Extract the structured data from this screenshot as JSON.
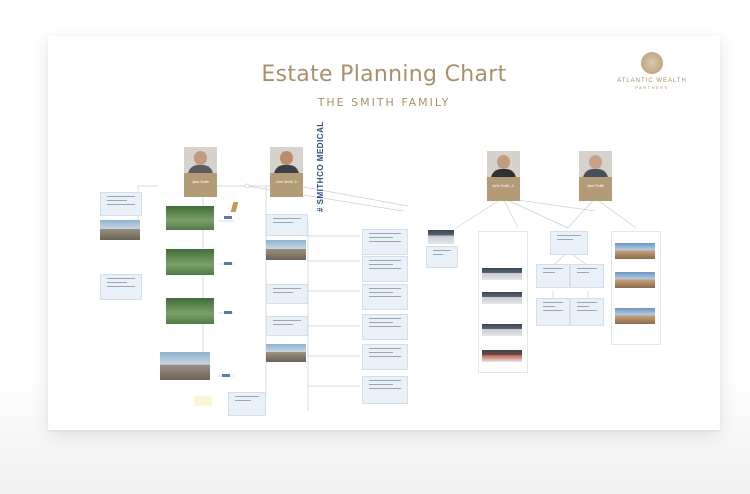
{
  "document": {
    "title": "Estate Planning Chart",
    "subtitle": "THE SMITH FAMILY"
  },
  "logo": {
    "name": "ATLANTIC WEALTH",
    "sub": "PARTNERS"
  },
  "people": [
    {
      "name": "Jane Smith"
    },
    {
      "name": "John Smith Jr."
    },
    {
      "name": "John Smith, Jr."
    },
    {
      "name": "Jane Smith"
    }
  ],
  "business": {
    "brand_label": "SMITHCO MEDICAL",
    "brand_mark": "#"
  },
  "colors": {
    "title": "#a8906c",
    "nameplate": "#b39b78",
    "card": "#e9f0f8",
    "brand": "#2b4a86"
  }
}
